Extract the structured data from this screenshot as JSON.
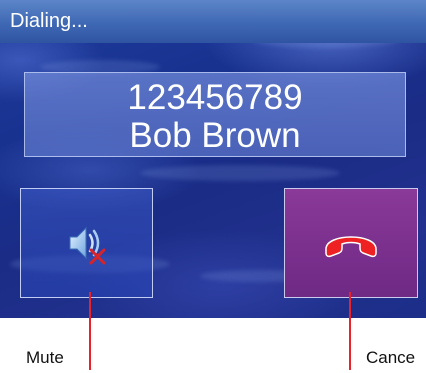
{
  "window": {
    "title": "Dialing..."
  },
  "call": {
    "number": "123456789",
    "name": "Bob Brown"
  },
  "buttons": {
    "mute_icon": "speaker-muted-icon",
    "cancel_icon": "hang-up-phone-icon",
    "cancel_color": "#ee2222"
  },
  "annotations": {
    "mute_label": "Mute",
    "cancel_label": "Cance",
    "pointer_color": "#e8232b"
  }
}
